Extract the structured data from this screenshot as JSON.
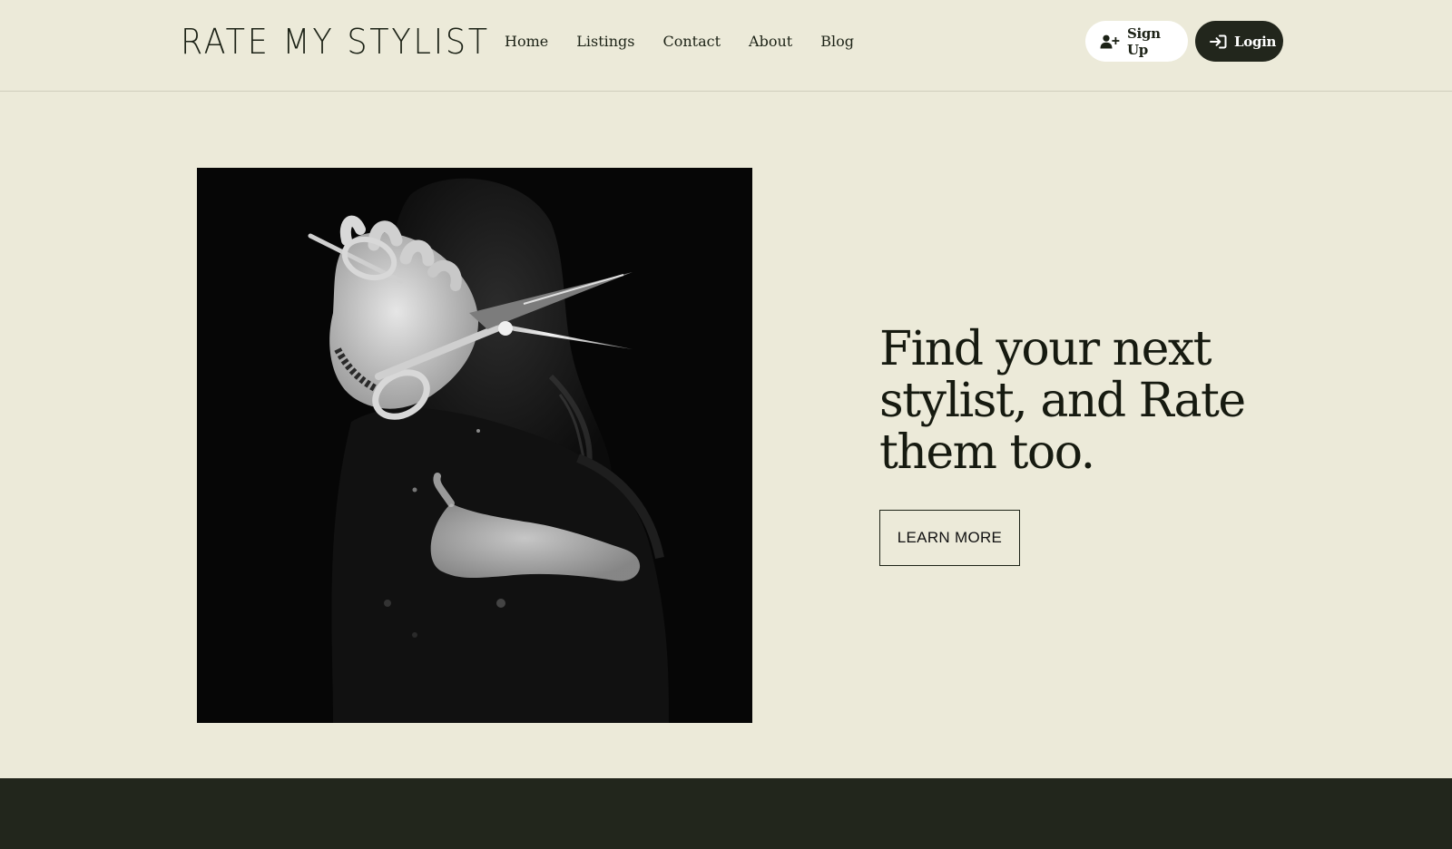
{
  "header": {
    "logo": "RATE MY STYLIST",
    "nav": [
      "Home",
      "Listings",
      "Contact",
      "About",
      "Blog"
    ],
    "signup_label": "Sign Up",
    "login_label": "Login"
  },
  "hero": {
    "headline": "Find your next stylist, and Rate them too.",
    "cta_label": "LEARN MORE"
  },
  "colors": {
    "background": "#ecead9",
    "accent_dark": "#22261c",
    "text": "#1c2216"
  },
  "icons": {
    "signup": "user-plus-icon",
    "login": "sign-in-icon"
  }
}
